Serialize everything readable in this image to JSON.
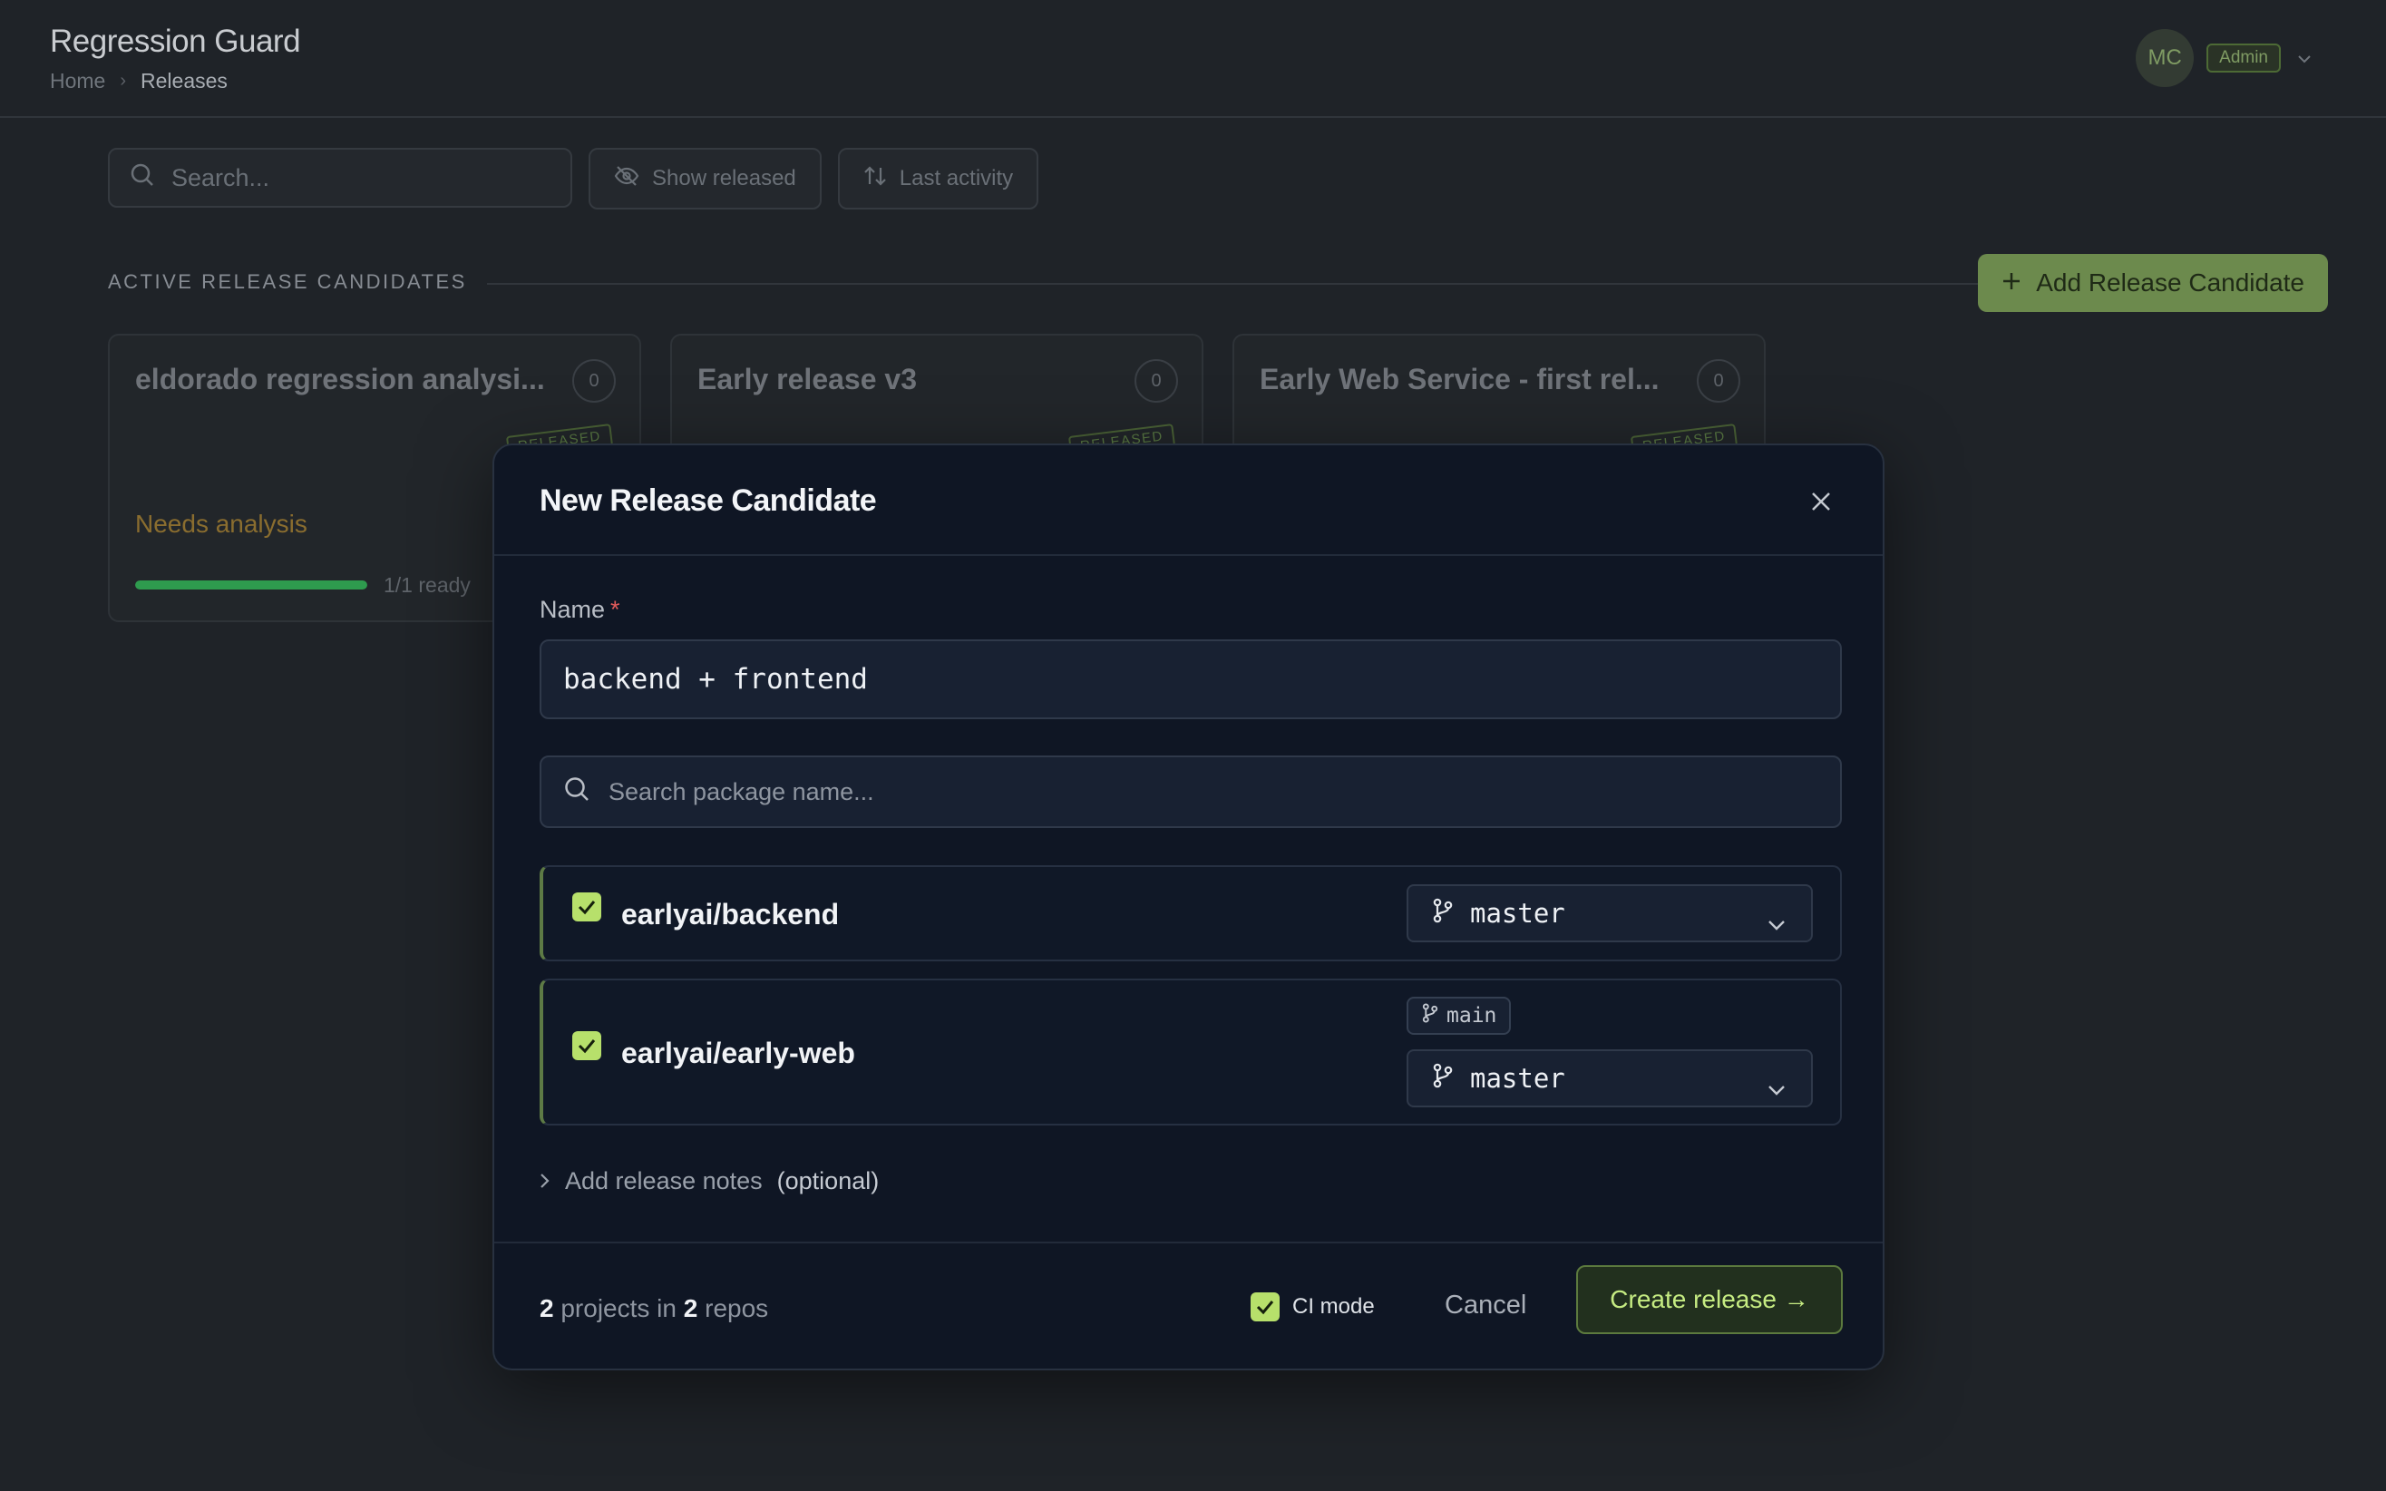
{
  "app": {
    "title": "Regression Guard",
    "breadcrumb": {
      "home": "Home",
      "current": "Releases"
    }
  },
  "user": {
    "initials": "MC",
    "role": "Admin"
  },
  "toolbar": {
    "search_placeholder": "Search...",
    "show_released_label": "Show released",
    "sort_label": "Last activity"
  },
  "section": {
    "title": "ACTIVE RELEASE CANDIDATES",
    "add_button_label": "Add Release Candidate"
  },
  "cards": [
    {
      "title": "eldorado regression analysi...",
      "count": "0",
      "stamp": "RELEASED",
      "status": "Needs analysis",
      "progress": 1.0,
      "progress_label": "1/1 ready"
    },
    {
      "title": "Early release v3",
      "count": "0",
      "stamp": "RELEASED"
    },
    {
      "title": "Early Web Service - first rel...",
      "count": "0",
      "stamp": "RELEASED"
    }
  ],
  "modal": {
    "title": "New Release Candidate",
    "name_label": "Name",
    "required_marker": "*",
    "name_value": "backend + frontend",
    "package_search_placeholder": "Search package name...",
    "packages": [
      {
        "name": "earlyai/backend",
        "checked": true,
        "branch": "master"
      },
      {
        "name": "earlyai/early-web",
        "checked": true,
        "default_branch_tag": "main",
        "branch": "master"
      }
    ],
    "notes_label": "Add release notes",
    "notes_optional": "(optional)",
    "footer": {
      "projects_count": "2",
      "projects_text": "projects in",
      "repos_count": "2",
      "repos_text": "repos",
      "ci_mode_label": "CI mode",
      "ci_mode_checked": true,
      "cancel_label": "Cancel",
      "create_label": "Create release →"
    }
  },
  "colors": {
    "accent": "#b7e06b",
    "primary_button": "#6c8a4d",
    "modal_bg": "#0f1624",
    "page_bg": "#1f2328",
    "required": "#e05a5a",
    "warning_text": "#8a6d2f",
    "progress_fill": "#2e9b4e"
  },
  "icons": [
    "search-icon",
    "eye-off-icon",
    "sort-icon",
    "plus-icon",
    "close-icon",
    "git-branch-icon",
    "chevron-down-icon",
    "chevron-right-icon",
    "check-icon"
  ]
}
